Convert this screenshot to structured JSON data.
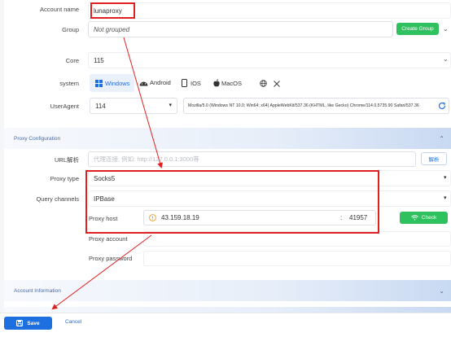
{
  "form": {
    "account_name_label": "Account name",
    "account_name_value": "lunaproxy",
    "group_label": "Group",
    "group_value": "Not grouped",
    "create_group_label": "Create Group",
    "core_label": "Core",
    "core_value": "115",
    "system_label": "system",
    "os_options": [
      "Windows",
      "Android",
      "IOS",
      "MacOS"
    ],
    "os_selected": "Windows",
    "useragent_label": "UserAgent",
    "useragent_version": "114",
    "useragent_string": "Mozilla/5.0 (Windows NT 10.0; Win64; x64) AppleWebKit/537.36 (KHTML, like Gecko) Chrome/114.0.5735.90 Safari/537.36"
  },
  "proxy_section": {
    "title": "Proxy Configuration",
    "url_label": "URL解析",
    "url_placeholder": "代理连接, 例如: http://127.0.0.1:3000等",
    "parse_button": "解析",
    "proxy_type_label": "Proxy type",
    "proxy_type_value": "Socks5",
    "query_channels_label": "Query channels",
    "query_channels_value": "IPBase",
    "proxy_host_label": "Proxy host",
    "proxy_host_value": "43.159.18.19",
    "proxy_port_value": "41957",
    "check_button": "Check",
    "proxy_account_label": "Proxy account",
    "proxy_password_label": "Proxy password"
  },
  "account_section": {
    "title": "Account Information"
  },
  "footer": {
    "save_label": "Save",
    "cancel_label": "Cancel"
  },
  "colors": {
    "accent_blue": "#1e6fe0",
    "check_green": "#2fc15d",
    "annotation_red": "#e02020",
    "warning_orange": "#f0a020"
  }
}
